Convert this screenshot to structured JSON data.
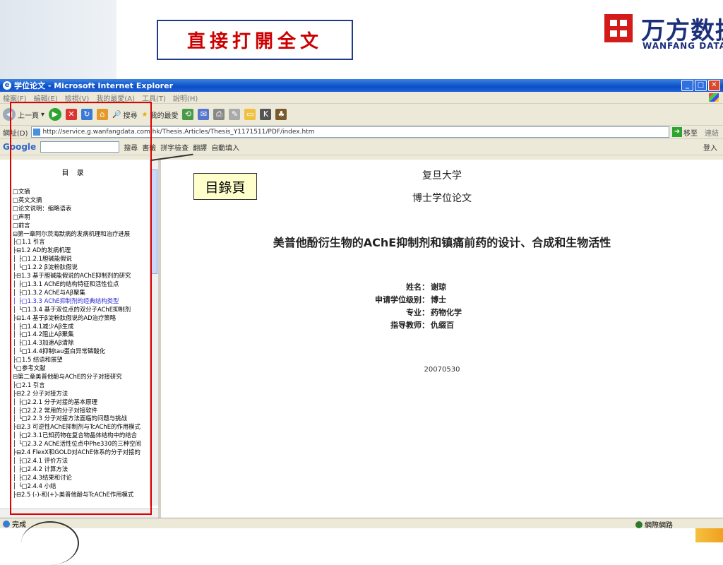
{
  "slide": {
    "heading": "直接打開全文",
    "logo_cn": "万方数据",
    "logo_en": "WANFANG DATA",
    "callout": "目錄頁"
  },
  "window": {
    "title": "学位论文 - Microsoft Internet Explorer",
    "menu": [
      "檔案(F)",
      "編輯(E)",
      "檢視(V)",
      "我的最愛(A)",
      "工具(T)",
      "說明(H)"
    ],
    "toolbar": {
      "back": "上一頁",
      "search": "搜尋",
      "favorites": "我的最愛"
    },
    "address": {
      "label": "網址(D)",
      "url": "http://service.g.wanfangdata.com.hk/Thesis.Articles/Thesis_Y1171511/PDF/index.htm",
      "go": "移至",
      "links": "連結"
    },
    "google_bar": {
      "logo": "Google",
      "search": "搜尋",
      "bookmarks": "書籤",
      "spell": "拼字檢查",
      "translate": "翻譯",
      "autofill": "自動填入",
      "login": "登入"
    },
    "status": {
      "text": "完成",
      "zone": "網際網路"
    }
  },
  "toc": {
    "title": "目 录",
    "items": [
      "□文摘",
      "□英文文摘",
      "□论文说明：缩略语表",
      "□声明",
      "□前言",
      "⊟第一章阿尔茨海默病的发病机理和治疗进展",
      "├□1.1 引言",
      "├⊟1.2 AD的发病机理",
      "│ ├□1.2.1胆碱能假说",
      "│ └□1.2.2 β淀粉肽假说",
      "├⊟1.3 基于胆碱能假说的AChE抑制剂的研究",
      "│ ├□1.3.1 AChE的结构特征和活性位点",
      "│ ├□1.3.2 AChE与Aβ聚集",
      "│ ├□1.3.3 AChE抑制剂的经典结构类型",
      "│ └□1.3.4 基于双位点的双分子AChE抑制剂",
      "├⊟1.4 基于β淀粉肽假说的AD治疗策略",
      "│ ├□1.4.1减少Aβ生成",
      "│ ├□1.4.2阻止Aβ聚集",
      "│ ├□1.4.3加速Aβ清除",
      "│ └□1.4.4抑制tau蛋白异常磷酸化",
      "├□1.5 结语和展望",
      "└□参考文献",
      "⊟第二章美普他酚与AChE的分子对接研究",
      "├□2.1 引言",
      "├⊟2.2 分子对接方法",
      "│ ├□2.2.1 分子对接的基本原理",
      "│ ├□2.2.2 常用的分子对接软件",
      "│ └□2.2.3 分子对接方法面临的问题与挑战",
      "├⊟2.3 可逆性AChE抑制剂与TcAChE的作用模式",
      "│ ├□2.3.1已知药物在复合物晶体结构中的结合",
      "│ └□2.3.2 AChE活性位点中Phe330的三种空间",
      "├⊟2.4 FlexX和GOLD对AChE体系的分子对接的",
      "│ ├□2.4.1 评价方法",
      "│ ├□2.4.2 计算方法",
      "│ ├□2.4.3结果和讨论",
      "│ └□2.4.4 小结",
      "├⊟2.5 (-)-和(+)-美普他酚与TcAChE作用模式"
    ],
    "highlight_index": 13
  },
  "doc": {
    "university": "复旦大学",
    "type": "博士学位论文",
    "title": "美普他酚衍生物的AChE抑制剂和镇痛前药的设计、合成和生物活性",
    "fields": [
      {
        "label": "姓名：",
        "value": "谢琼"
      },
      {
        "label": "申请学位级别：",
        "value": "博士"
      },
      {
        "label": "专业：",
        "value": "药物化学"
      },
      {
        "label": "指导教师：",
        "value": "仇缀百"
      }
    ],
    "date": "20070530"
  },
  "colors": {
    "heading": "#cc0000",
    "frame": "#e00000",
    "titlebar": "#0a4fc8"
  }
}
